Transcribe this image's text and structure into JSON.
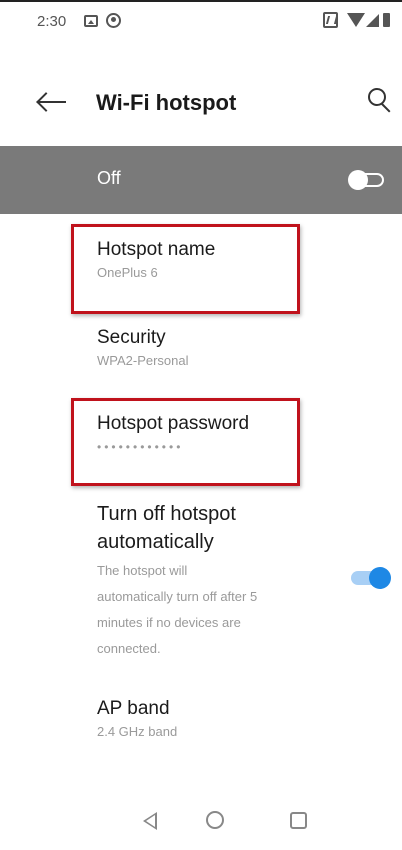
{
  "status_bar": {
    "time": "2:30",
    "icons": [
      "gallery-icon",
      "pinterest-icon",
      "nfc-icon",
      "wifi-icon",
      "signal-icon",
      "battery-icon"
    ]
  },
  "header": {
    "title": "Wi-Fi hotspot",
    "back_icon": "arrow-left-icon",
    "search_icon": "search-icon"
  },
  "master_switch": {
    "label": "Off",
    "state": "off"
  },
  "settings": {
    "hotspot_name": {
      "title": "Hotspot name",
      "value": "OnePlus 6"
    },
    "security": {
      "title": "Security",
      "value": "WPA2-Personal"
    },
    "hotspot_password": {
      "title": "Hotspot password",
      "value": "••••••••••••"
    },
    "auto_off": {
      "title_line1": "Turn off hotspot",
      "title_line2": "automatically",
      "desc_line1": "The hotspot will",
      "desc_line2": "automatically turn off after 5",
      "desc_line3": "minutes if no devices are",
      "desc_line4": "connected.",
      "state": "on"
    },
    "ap_band": {
      "title": "AP band",
      "value": "2.4 GHz band"
    }
  },
  "nav_bar": {
    "icons": [
      "nav-back-icon",
      "nav-home-icon",
      "nav-recents-icon"
    ]
  },
  "colors": {
    "master_bar": "#7a7a7a",
    "accent": "#1e88e5",
    "highlight": "#c0121c"
  }
}
